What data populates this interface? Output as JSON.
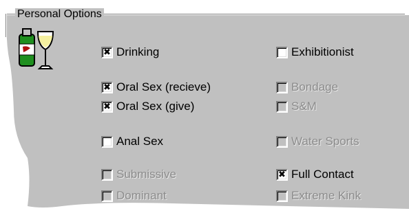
{
  "group": {
    "title": "Personal Options"
  },
  "icon": {
    "name": "drink-icon"
  },
  "options": {
    "drinking": {
      "label": "Drinking",
      "checked": true,
      "enabled": true
    },
    "exhibitionist": {
      "label": "Exhibitionist",
      "checked": false,
      "enabled": true
    },
    "oral_recieve": {
      "label": "Oral Sex (recieve)",
      "checked": true,
      "enabled": true
    },
    "bondage": {
      "label": "Bondage",
      "checked": false,
      "enabled": false
    },
    "oral_give": {
      "label": "Oral Sex (give)",
      "checked": true,
      "enabled": true
    },
    "sm": {
      "label": "S&M",
      "checked": false,
      "enabled": false
    },
    "anal": {
      "label": "Anal Sex",
      "checked": false,
      "enabled": true
    },
    "water_sports": {
      "label": "Water Sports",
      "checked": false,
      "enabled": false
    },
    "submissive": {
      "label": "Submissive",
      "checked": false,
      "enabled": false
    },
    "full_contact": {
      "label": "Full Contact",
      "checked": true,
      "enabled": true
    },
    "dominant": {
      "label": "Dominant",
      "checked": false,
      "enabled": false
    },
    "extreme_kink": {
      "label": "Extreme Kink",
      "checked": false,
      "enabled": false
    }
  },
  "colors": {
    "panel": "#c0c0c0",
    "disabled_text": "#8c8c8c"
  }
}
